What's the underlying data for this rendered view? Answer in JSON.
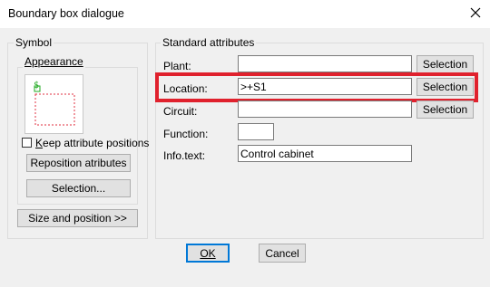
{
  "window": {
    "title": "Boundary box dialogue"
  },
  "symbol_group": {
    "label": "Symbol",
    "appearance_label": "Appearance",
    "preview_marker": "$",
    "keep_positions_label": "Keep attribute positions",
    "keep_positions_checked": false,
    "reposition_label": "Reposition atributes",
    "selection_label": "Selection...",
    "size_position_label": "Size and position >>"
  },
  "attributes_group": {
    "label": "Standard attributes",
    "rows": [
      {
        "label": "Plant:",
        "value": "",
        "button": "Selection"
      },
      {
        "label": "Location:",
        "value": ">+S1",
        "button": "Selection"
      },
      {
        "label": "Circuit:",
        "value": "",
        "button": "Selection"
      },
      {
        "label": "Function:",
        "value": ""
      },
      {
        "label": "Info.text:",
        "value": "Control cabinet"
      }
    ]
  },
  "footer": {
    "ok_label": "OK",
    "cancel_label": "Cancel"
  },
  "colors": {
    "highlight": "#e0212d",
    "focus": "#0078d7"
  }
}
